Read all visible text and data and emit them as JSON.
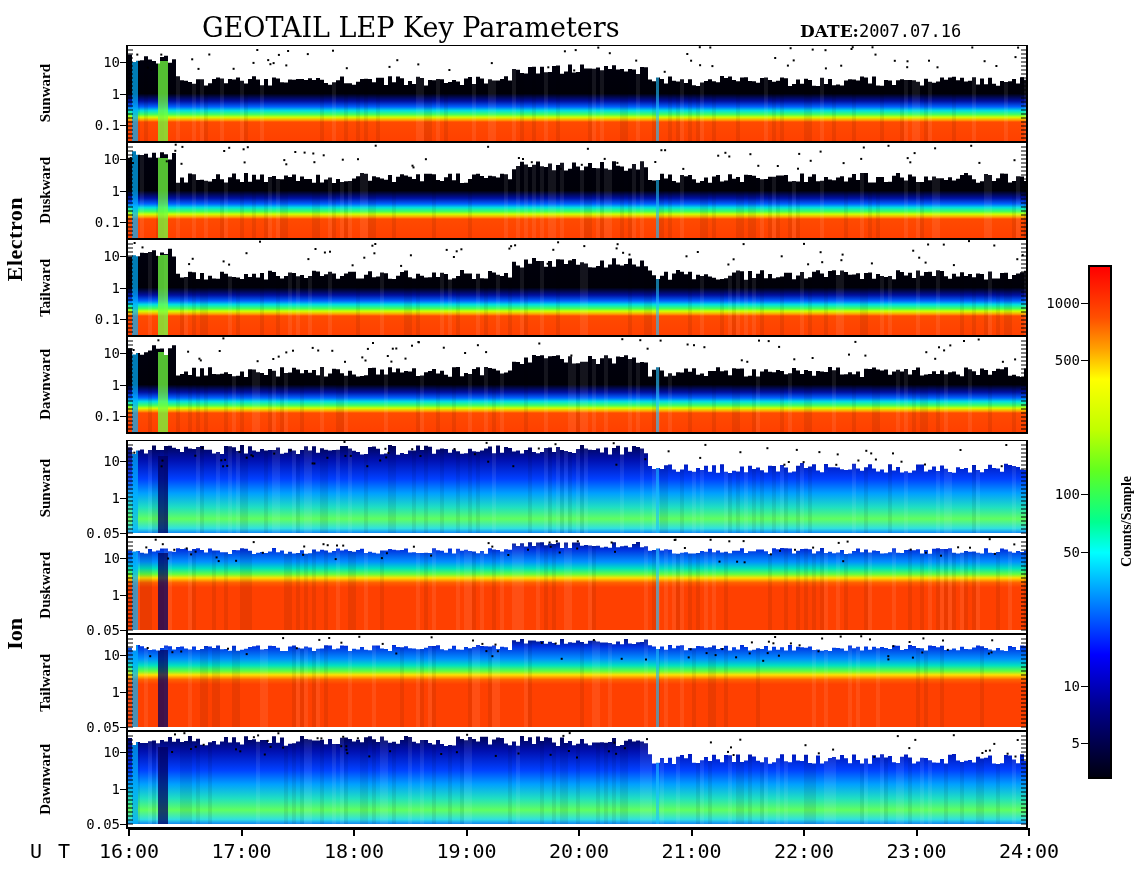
{
  "title": "GEOTAIL LEP Key Parameters",
  "date": "**DATE:**2007.07.16",
  "groups": [
    {
      "label": "Electron",
      "kind": "electron",
      "panels": [
        {
          "label": "Sunward",
          "kind": "electron",
          "yticks": [
            "10",
            "1",
            "0.1"
          ]
        },
        {
          "label": "Duskward",
          "kind": "electron",
          "yticks": [
            "10",
            "1",
            "0.1"
          ]
        },
        {
          "label": "Tailward",
          "kind": "electron",
          "yticks": [
            "10",
            "1",
            "0.1"
          ]
        },
        {
          "label": "Dawnward",
          "kind": "electron",
          "yticks": [
            "10",
            "1",
            "0.1"
          ]
        }
      ]
    },
    {
      "label": "Ion",
      "kind": "ion",
      "panels": [
        {
          "label": "Sunward",
          "kind": "cool",
          "yticks": [
            "10",
            "1",
            "0.05"
          ]
        },
        {
          "label": "Duskward",
          "kind": "warm",
          "yticks": [
            "10",
            "1",
            "0.05"
          ]
        },
        {
          "label": "Tailward",
          "kind": "warm",
          "yticks": [
            "10",
            "1",
            "0.05"
          ]
        },
        {
          "label": "Dawnward",
          "kind": "cool",
          "yticks": [
            "10",
            "1",
            "0.05"
          ]
        }
      ]
    }
  ],
  "colorbar": {
    "label": "Counts/Sample",
    "ticks": [
      "1000",
      "500",
      "100",
      "50",
      "10",
      "5"
    ]
  },
  "time_axis": {
    "label": "U T",
    "ticks": [
      "16:00",
      "17:00",
      "18:00",
      "19:00",
      "20:00",
      "21:00",
      "22:00",
      "23:00",
      "24:00"
    ]
  }
}
